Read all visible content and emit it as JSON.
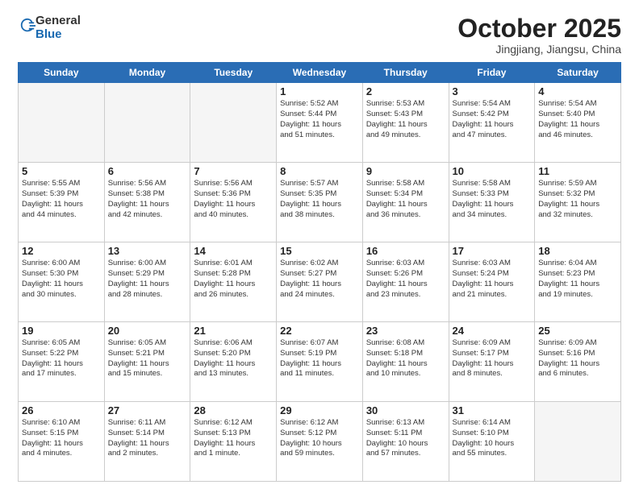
{
  "header": {
    "logo_general": "General",
    "logo_blue": "Blue",
    "month": "October 2025",
    "location": "Jingjiang, Jiangsu, China"
  },
  "weekdays": [
    "Sunday",
    "Monday",
    "Tuesday",
    "Wednesday",
    "Thursday",
    "Friday",
    "Saturday"
  ],
  "weeks": [
    [
      {
        "day": "",
        "info": ""
      },
      {
        "day": "",
        "info": ""
      },
      {
        "day": "",
        "info": ""
      },
      {
        "day": "1",
        "info": "Sunrise: 5:52 AM\nSunset: 5:44 PM\nDaylight: 11 hours\nand 51 minutes."
      },
      {
        "day": "2",
        "info": "Sunrise: 5:53 AM\nSunset: 5:43 PM\nDaylight: 11 hours\nand 49 minutes."
      },
      {
        "day": "3",
        "info": "Sunrise: 5:54 AM\nSunset: 5:42 PM\nDaylight: 11 hours\nand 47 minutes."
      },
      {
        "day": "4",
        "info": "Sunrise: 5:54 AM\nSunset: 5:40 PM\nDaylight: 11 hours\nand 46 minutes."
      }
    ],
    [
      {
        "day": "5",
        "info": "Sunrise: 5:55 AM\nSunset: 5:39 PM\nDaylight: 11 hours\nand 44 minutes."
      },
      {
        "day": "6",
        "info": "Sunrise: 5:56 AM\nSunset: 5:38 PM\nDaylight: 11 hours\nand 42 minutes."
      },
      {
        "day": "7",
        "info": "Sunrise: 5:56 AM\nSunset: 5:36 PM\nDaylight: 11 hours\nand 40 minutes."
      },
      {
        "day": "8",
        "info": "Sunrise: 5:57 AM\nSunset: 5:35 PM\nDaylight: 11 hours\nand 38 minutes."
      },
      {
        "day": "9",
        "info": "Sunrise: 5:58 AM\nSunset: 5:34 PM\nDaylight: 11 hours\nand 36 minutes."
      },
      {
        "day": "10",
        "info": "Sunrise: 5:58 AM\nSunset: 5:33 PM\nDaylight: 11 hours\nand 34 minutes."
      },
      {
        "day": "11",
        "info": "Sunrise: 5:59 AM\nSunset: 5:32 PM\nDaylight: 11 hours\nand 32 minutes."
      }
    ],
    [
      {
        "day": "12",
        "info": "Sunrise: 6:00 AM\nSunset: 5:30 PM\nDaylight: 11 hours\nand 30 minutes."
      },
      {
        "day": "13",
        "info": "Sunrise: 6:00 AM\nSunset: 5:29 PM\nDaylight: 11 hours\nand 28 minutes."
      },
      {
        "day": "14",
        "info": "Sunrise: 6:01 AM\nSunset: 5:28 PM\nDaylight: 11 hours\nand 26 minutes."
      },
      {
        "day": "15",
        "info": "Sunrise: 6:02 AM\nSunset: 5:27 PM\nDaylight: 11 hours\nand 24 minutes."
      },
      {
        "day": "16",
        "info": "Sunrise: 6:03 AM\nSunset: 5:26 PM\nDaylight: 11 hours\nand 23 minutes."
      },
      {
        "day": "17",
        "info": "Sunrise: 6:03 AM\nSunset: 5:24 PM\nDaylight: 11 hours\nand 21 minutes."
      },
      {
        "day": "18",
        "info": "Sunrise: 6:04 AM\nSunset: 5:23 PM\nDaylight: 11 hours\nand 19 minutes."
      }
    ],
    [
      {
        "day": "19",
        "info": "Sunrise: 6:05 AM\nSunset: 5:22 PM\nDaylight: 11 hours\nand 17 minutes."
      },
      {
        "day": "20",
        "info": "Sunrise: 6:05 AM\nSunset: 5:21 PM\nDaylight: 11 hours\nand 15 minutes."
      },
      {
        "day": "21",
        "info": "Sunrise: 6:06 AM\nSunset: 5:20 PM\nDaylight: 11 hours\nand 13 minutes."
      },
      {
        "day": "22",
        "info": "Sunrise: 6:07 AM\nSunset: 5:19 PM\nDaylight: 11 hours\nand 11 minutes."
      },
      {
        "day": "23",
        "info": "Sunrise: 6:08 AM\nSunset: 5:18 PM\nDaylight: 11 hours\nand 10 minutes."
      },
      {
        "day": "24",
        "info": "Sunrise: 6:09 AM\nSunset: 5:17 PM\nDaylight: 11 hours\nand 8 minutes."
      },
      {
        "day": "25",
        "info": "Sunrise: 6:09 AM\nSunset: 5:16 PM\nDaylight: 11 hours\nand 6 minutes."
      }
    ],
    [
      {
        "day": "26",
        "info": "Sunrise: 6:10 AM\nSunset: 5:15 PM\nDaylight: 11 hours\nand 4 minutes."
      },
      {
        "day": "27",
        "info": "Sunrise: 6:11 AM\nSunset: 5:14 PM\nDaylight: 11 hours\nand 2 minutes."
      },
      {
        "day": "28",
        "info": "Sunrise: 6:12 AM\nSunset: 5:13 PM\nDaylight: 11 hours\nand 1 minute."
      },
      {
        "day": "29",
        "info": "Sunrise: 6:12 AM\nSunset: 5:12 PM\nDaylight: 10 hours\nand 59 minutes."
      },
      {
        "day": "30",
        "info": "Sunrise: 6:13 AM\nSunset: 5:11 PM\nDaylight: 10 hours\nand 57 minutes."
      },
      {
        "day": "31",
        "info": "Sunrise: 6:14 AM\nSunset: 5:10 PM\nDaylight: 10 hours\nand 55 minutes."
      },
      {
        "day": "",
        "info": ""
      }
    ]
  ]
}
